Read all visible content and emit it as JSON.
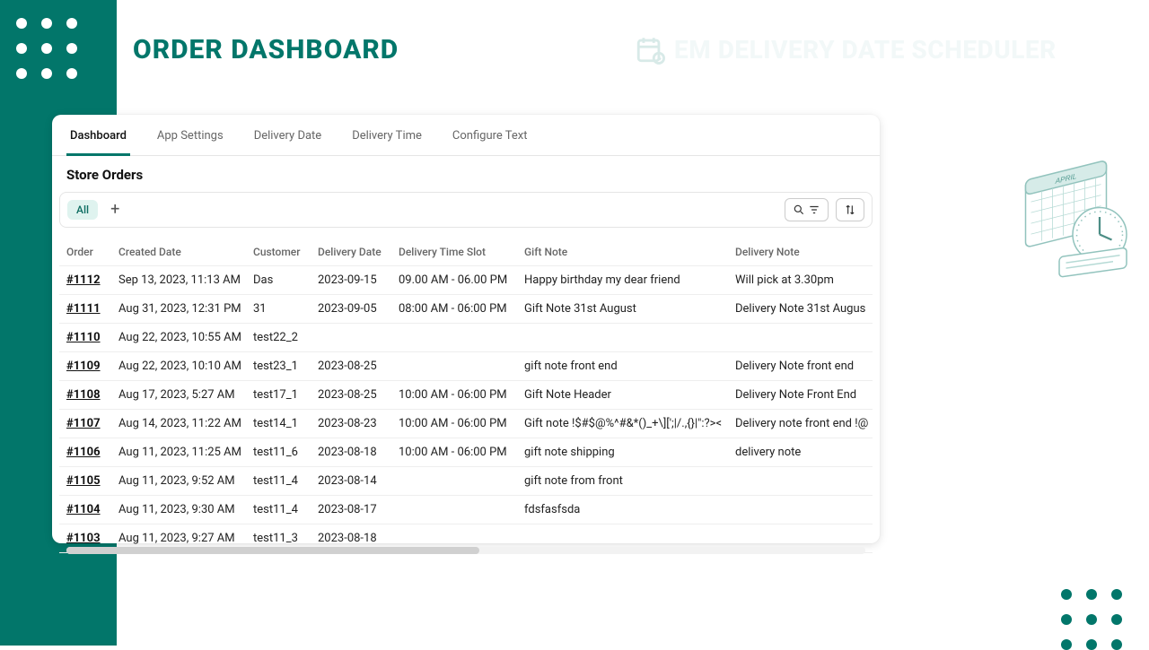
{
  "page_title": "ORDER DASHBOARD",
  "brand_title": "EM DELIVERY DATE SCHEDULER",
  "tabs": {
    "dashboard": "Dashboard",
    "app_settings": "App Settings",
    "delivery_date": "Delivery Date",
    "delivery_time": "Delivery Time",
    "configure_text": "Configure Text"
  },
  "section_title": "Store Orders",
  "toolbar": {
    "all_label": "All"
  },
  "columns": {
    "order": "Order",
    "created": "Created Date",
    "customer": "Customer",
    "ddate": "Delivery Date",
    "dslot": "Delivery Time Slot",
    "gift": "Gift Note",
    "dnote": "Delivery Note"
  },
  "rows": [
    {
      "order": "#1112",
      "created": "Sep 13, 2023, 11:13 AM",
      "customer": "Das",
      "ddate": "2023-09-15",
      "dslot": "09.00 AM - 06.00 PM",
      "gift": "Happy birthday my dear friend",
      "dnote": "Will pick at 3.30pm"
    },
    {
      "order": "#1111",
      "created": "Aug 31, 2023, 12:31 PM",
      "customer": "31",
      "ddate": "2023-09-05",
      "dslot": "08:00 AM - 06:00 PM",
      "gift": "Gift Note 31st August",
      "dnote": "Delivery Note 31st Augus"
    },
    {
      "order": "#1110",
      "created": "Aug 22, 2023, 10:55 AM",
      "customer": "test22_2",
      "ddate": "",
      "dslot": "",
      "gift": "",
      "dnote": ""
    },
    {
      "order": "#1109",
      "created": "Aug 22, 2023, 10:10 AM",
      "customer": "test23_1",
      "ddate": "2023-08-25",
      "dslot": "",
      "gift": "gift note front end",
      "dnote": "Delivery Note front end"
    },
    {
      "order": "#1108",
      "created": "Aug 17, 2023, 5:27 AM",
      "customer": "test17_1",
      "ddate": "2023-08-25",
      "dslot": "10:00 AM - 06:00 PM",
      "gift": "Gift Note Header",
      "dnote": "Delivery Note Front End"
    },
    {
      "order": "#1107",
      "created": "Aug 14, 2023, 11:22 AM",
      "customer": "test14_1",
      "ddate": "2023-08-23",
      "dslot": "10:00 AM - 06:00 PM",
      "gift": "Gift note !$#$@%^#&*()_+\\][';|/.,{}|\":?><",
      "dnote": "Delivery note front end !@"
    },
    {
      "order": "#1106",
      "created": "Aug 11, 2023, 11:25 AM",
      "customer": "test11_6",
      "ddate": "2023-08-18",
      "dslot": "10:00 AM - 06:00 PM",
      "gift": "gift note shipping",
      "dnote": "delivery note"
    },
    {
      "order": "#1105",
      "created": "Aug 11, 2023, 9:52 AM",
      "customer": "test11_4",
      "ddate": "2023-08-14",
      "dslot": "",
      "gift": "gift note from front",
      "dnote": ""
    },
    {
      "order": "#1104",
      "created": "Aug 11, 2023, 9:30 AM",
      "customer": "test11_4",
      "ddate": "2023-08-17",
      "dslot": "",
      "gift": "fdsfasfsda",
      "dnote": ""
    },
    {
      "order": "#1103",
      "created": "Aug 11, 2023, 9:27 AM",
      "customer": "test11_3",
      "ddate": "2023-08-18",
      "dslot": "",
      "gift": "",
      "dnote": ""
    }
  ]
}
